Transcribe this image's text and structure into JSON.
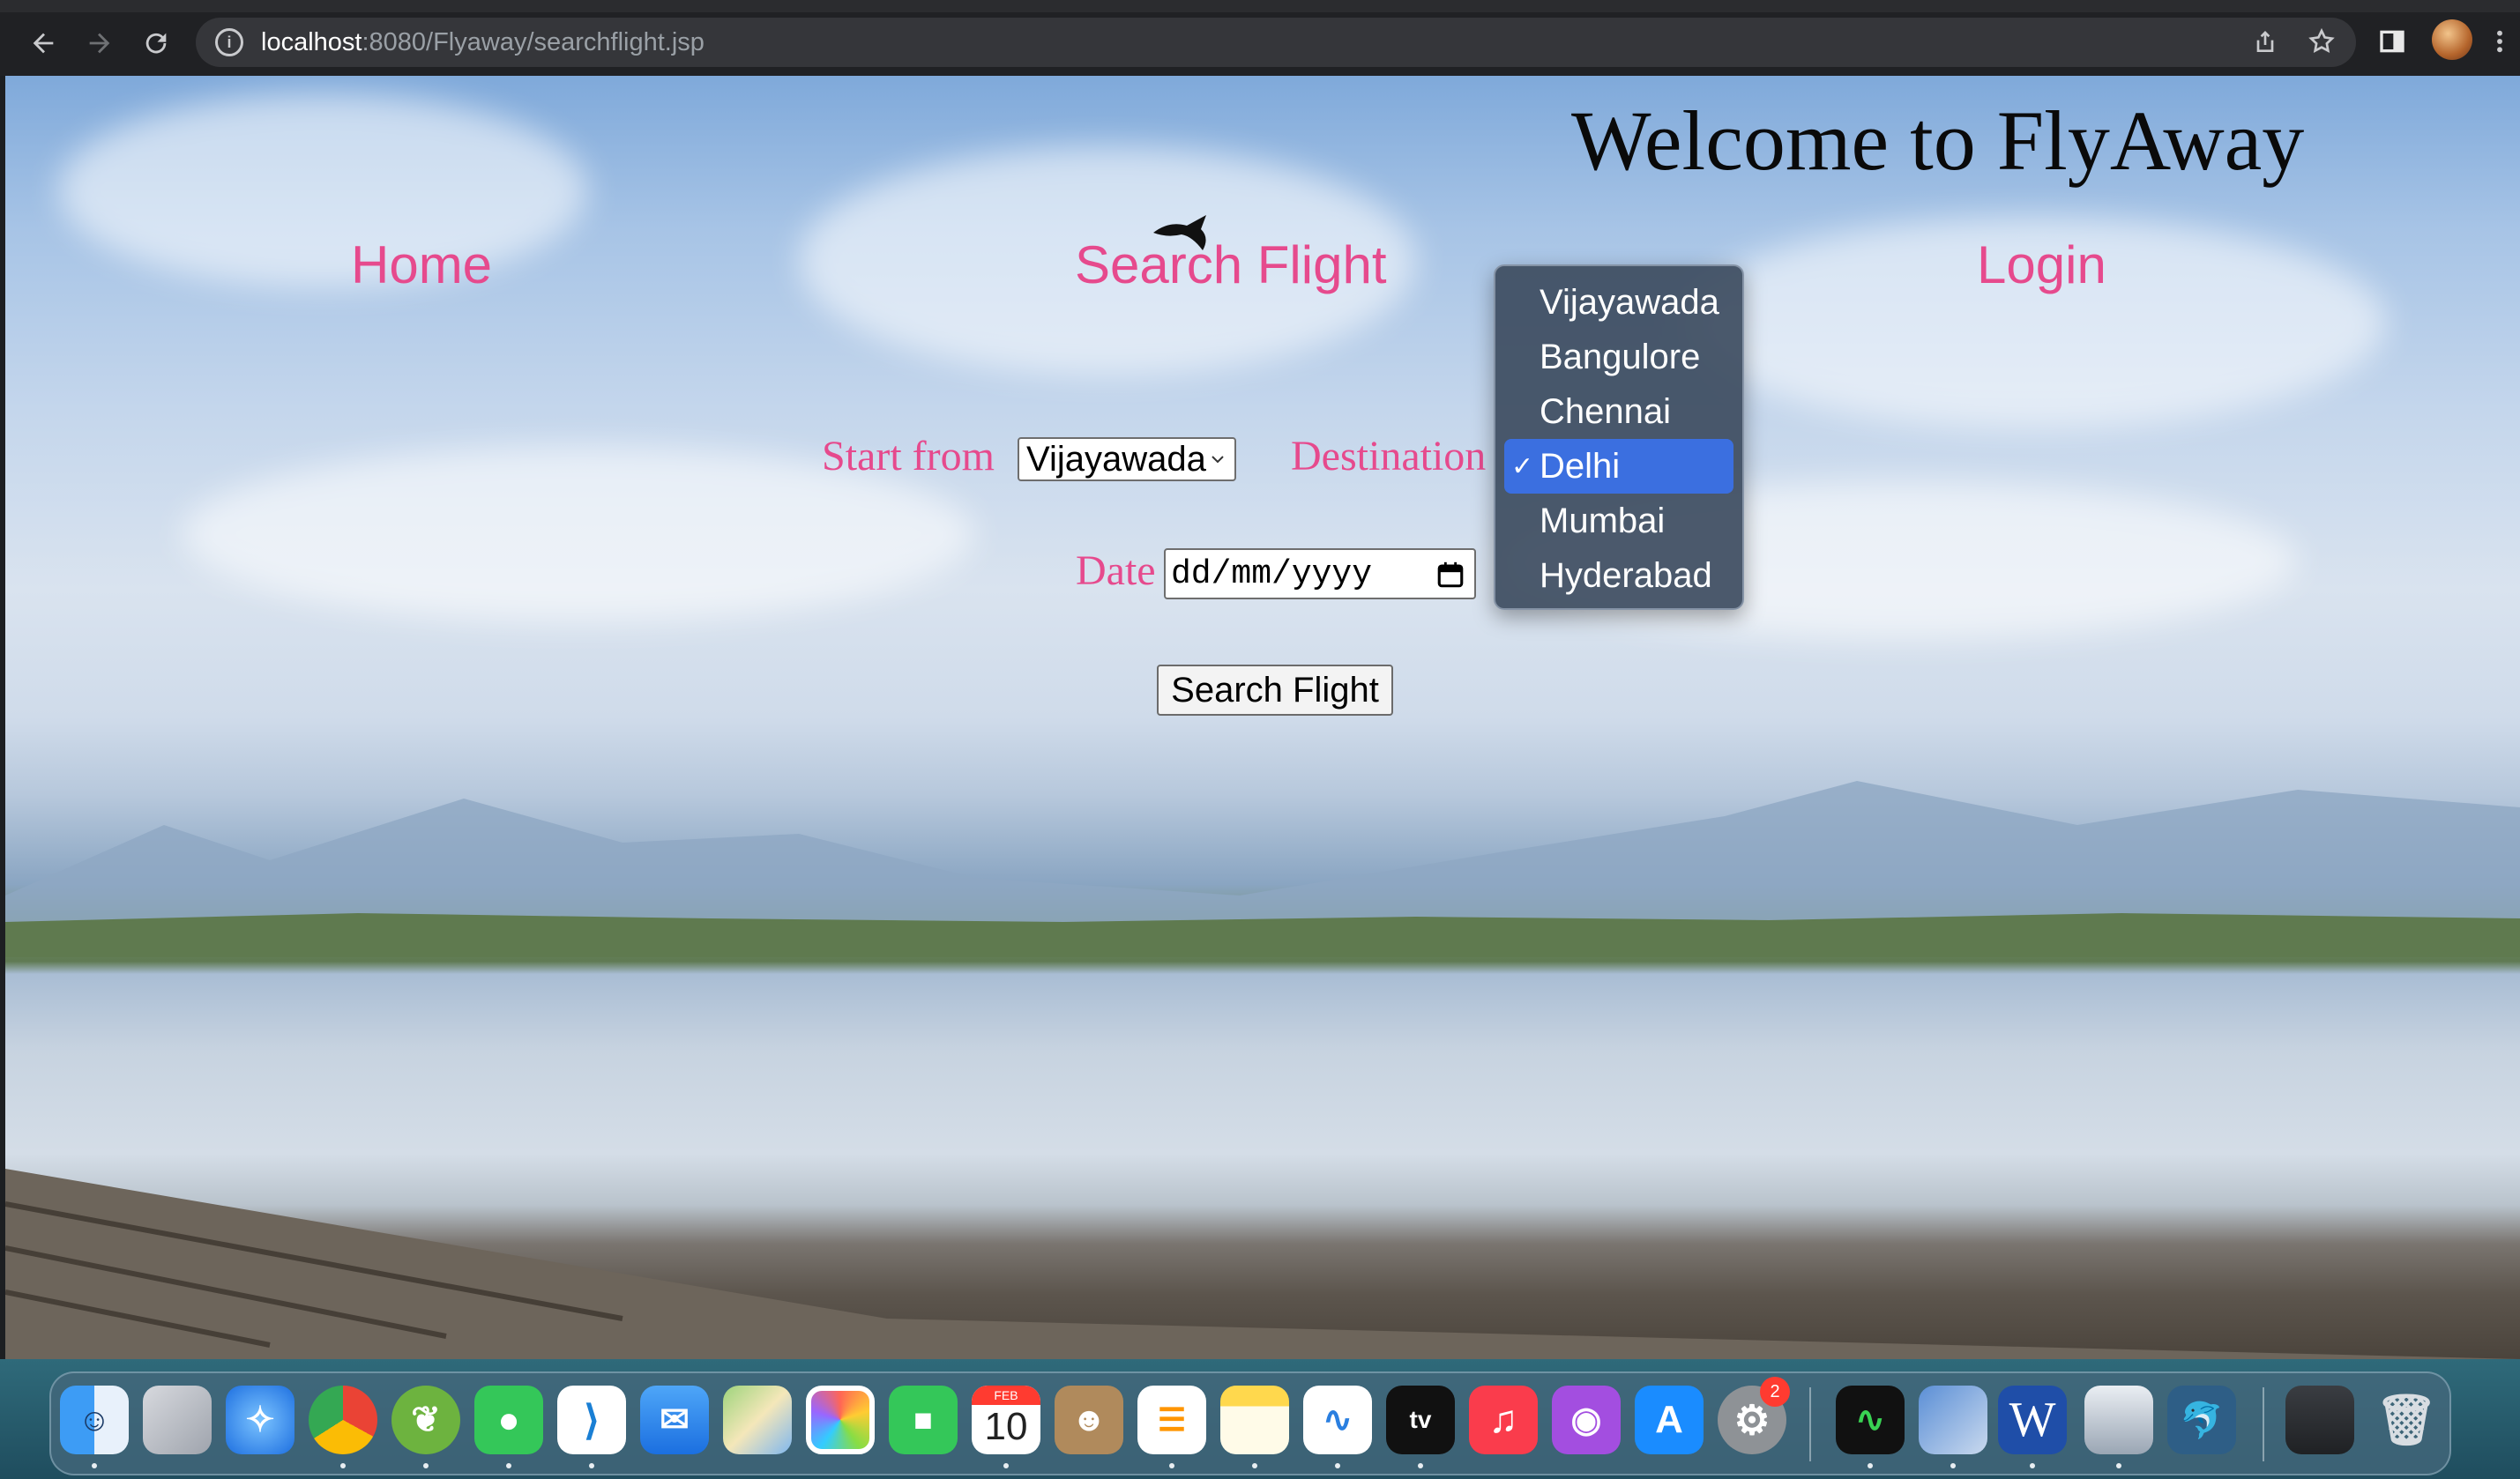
{
  "browser": {
    "url_host": "localhost",
    "url_rest": ":8080/Flyaway/searchflight.jsp"
  },
  "page": {
    "title": "Welcome to FlyAway",
    "nav": {
      "home": "Home",
      "search_flight": "Search Flight",
      "login": "Login"
    },
    "form": {
      "start_label": "Start from",
      "start_value": "Vijayawada",
      "destination_label": "Destination",
      "date_label": "Date",
      "date_placeholder": "dd/mm/yyyy",
      "submit_label": "Search Flight"
    },
    "destination_dropdown": {
      "options": [
        "Vijayawada",
        "Bangulore",
        "Chennai",
        "Delhi",
        "Mumbai",
        "Hyderabad"
      ],
      "selected": "Delhi",
      "check_mark": "✓"
    }
  },
  "dock": {
    "calendar_month": "FEB",
    "calendar_day": "10",
    "tv_label": "tv",
    "settings_badge": "2",
    "word_letter": "W"
  }
}
